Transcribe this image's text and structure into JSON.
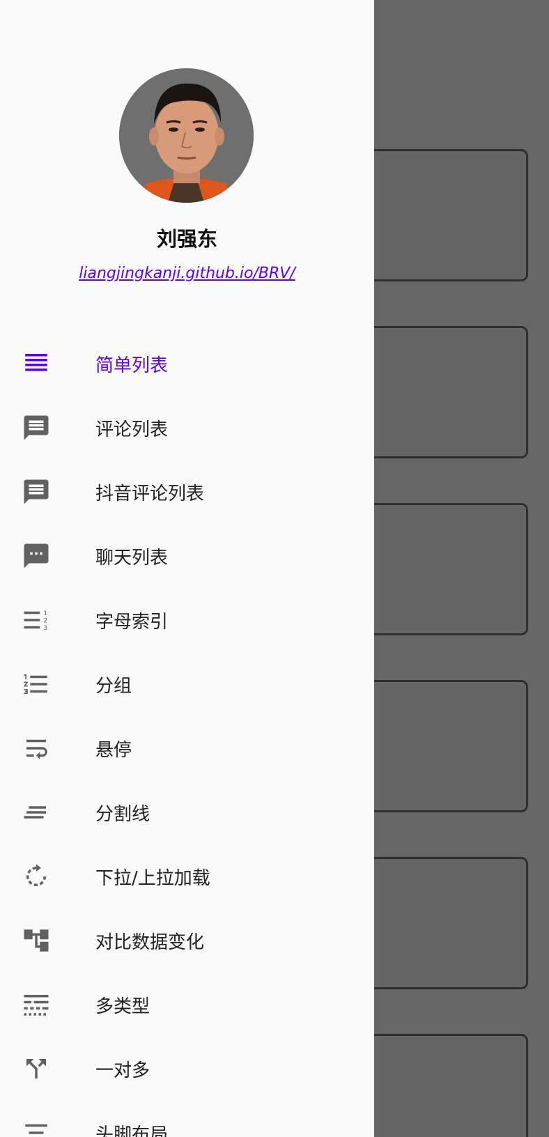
{
  "colors": {
    "accent": "#6200ee",
    "icon": "#616161",
    "scrim": "#666666",
    "drawer_bg": "#fafafa"
  },
  "profile": {
    "name": "刘强东",
    "link": "liangjingkanji.github.io/BRV/"
  },
  "menu": {
    "items": [
      {
        "label": "简单列表",
        "icon": "list-icon",
        "active": true
      },
      {
        "label": "评论列表",
        "icon": "comment-icon",
        "active": false
      },
      {
        "label": "抖音评论列表",
        "icon": "comment-icon",
        "active": false
      },
      {
        "label": "聊天列表",
        "icon": "chat-bubble-icon",
        "active": false
      },
      {
        "label": "字母索引",
        "icon": "alphabet-index-icon",
        "active": false
      },
      {
        "label": "分组",
        "icon": "numbered-list-icon",
        "active": false
      },
      {
        "label": "悬停",
        "icon": "wrap-text-icon",
        "active": false
      },
      {
        "label": "分割线",
        "icon": "divider-lines-icon",
        "active": false
      },
      {
        "label": "下拉/上拉加载",
        "icon": "refresh-icon",
        "active": false
      },
      {
        "label": "对比数据变化",
        "icon": "tree-diff-icon",
        "active": false
      },
      {
        "label": "多类型",
        "icon": "multi-type-icon",
        "active": false
      },
      {
        "label": "一对多",
        "icon": "split-icon",
        "active": false
      },
      {
        "label": "头脚布局",
        "icon": "header-footer-icon",
        "active": false
      }
    ]
  }
}
